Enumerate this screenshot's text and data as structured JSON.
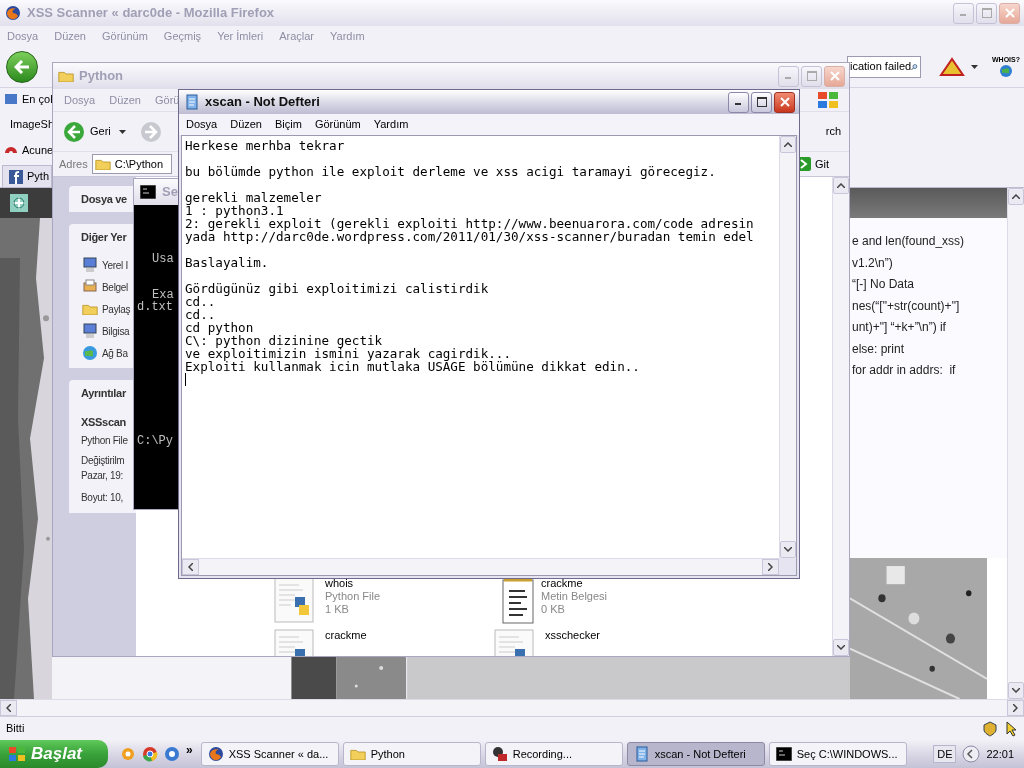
{
  "firefox": {
    "title": "XSS Scanner « darc0de - Mozilla Firefox",
    "menu": [
      "Dosya",
      "Düzen",
      "Görünüm",
      "Geçmiş",
      "Yer İmleri",
      "Araçlar",
      "Yardım"
    ],
    "search": {
      "value": "ication failed"
    },
    "whois_label": "WHOIS?",
    "bookmarks": [
      {
        "label": "En çol",
        "kind": "star"
      },
      {
        "label": "ImageSh",
        "kind": "plain"
      },
      {
        "label": "Acune",
        "kind": "red"
      }
    ],
    "tab": {
      "label": "Pyth",
      "selected": false
    },
    "code_lines": [
      "e and len(found_xss)",
      "v1.2\\n”)",
      "“[-] No Data",
      "nes(“[\"+str(count)+\"]",
      "unt)+\"] “+k+”\\n”) if",
      "else: print",
      "for addr in addrs:  if"
    ],
    "status": "Bitti"
  },
  "explorer": {
    "title": "Python",
    "menu": [
      "Dosya",
      "Düzen",
      "Görü"
    ],
    "back_label": "Geri",
    "search_label": "rch",
    "address_label": "Adres",
    "address": "C:\\Python",
    "go_label": "Git",
    "panes": [
      {
        "title": "Dosya ve"
      },
      {
        "title": "Diğer Yer",
        "items": [
          {
            "label": "Yerel I",
            "kind": "computer"
          },
          {
            "label": "Belgel",
            "kind": "printer"
          },
          {
            "label": "Paylaş",
            "kind": "folder"
          },
          {
            "label": "Bilgisa",
            "kind": "computer"
          },
          {
            "label": "Ağ Ba",
            "kind": "network"
          }
        ]
      },
      {
        "title": "Ayrıntılar",
        "details": [
          "XSSscan",
          "Python File",
          "Değiştirilm",
          "Pazar, 19:",
          "Boyut: 10,"
        ]
      }
    ],
    "files": [
      {
        "name": "whois",
        "type": "Python File",
        "size": "1 KB",
        "kind": "python"
      },
      {
        "name": "crackme",
        "type": "Metin Belgesi",
        "size": "0 KB",
        "kind": "text"
      },
      {
        "name": "crackme",
        "kind": "python"
      },
      {
        "name": "xsschecker",
        "kind": "python"
      }
    ]
  },
  "console": {
    "title": "Se",
    "lines": [
      "Usa",
      "Exa",
      "d.txt",
      "C:\\Py"
    ]
  },
  "notepad": {
    "title": "xscan - Not Defteri",
    "menu": [
      "Dosya",
      "Düzen",
      "Biçim",
      "Görünüm",
      "Yardım"
    ],
    "paragraphs": [
      [
        "Herkese merhba tekrar"
      ],
      [
        "bu bölümde python ile exploit derleme ve xss acigi taramayi görecegiz."
      ],
      [
        "gerekli malzemeler",
        "1 : python3.1",
        "2: gerekli exploit (gerekli exploiti http://www.beenuarora.com/code adresin",
        "yada http://darc0de.wordpress.com/2011/01/30/xss-scanner/buradan temin edel"
      ],
      [
        "Baslayalim."
      ],
      [
        "Gördügünüz gibi exploitimizi calistirdik",
        "cd..",
        "cd..",
        "cd python",
        "C\\: python dizinine gectik",
        "ve exploitimizin ismini yazarak cagirdik...",
        "Exploiti kullanmak icin mutlaka USAGE bölümüne dikkat edin.."
      ]
    ]
  },
  "taskbar": {
    "start": "Başlat",
    "more": "»",
    "tasks": [
      {
        "label": "XSS Scanner « da...",
        "kind": "firefox",
        "selected": false
      },
      {
        "label": "Python",
        "kind": "folder",
        "selected": false
      },
      {
        "label": "Recording...",
        "kind": "record",
        "selected": false
      },
      {
        "label": "xscan - Not Defteri",
        "kind": "notepad",
        "selected": true
      },
      {
        "label": "Seç C:\\WINDOWS...",
        "kind": "console",
        "selected": false
      }
    ],
    "language": "DE",
    "clock": "22:01"
  }
}
